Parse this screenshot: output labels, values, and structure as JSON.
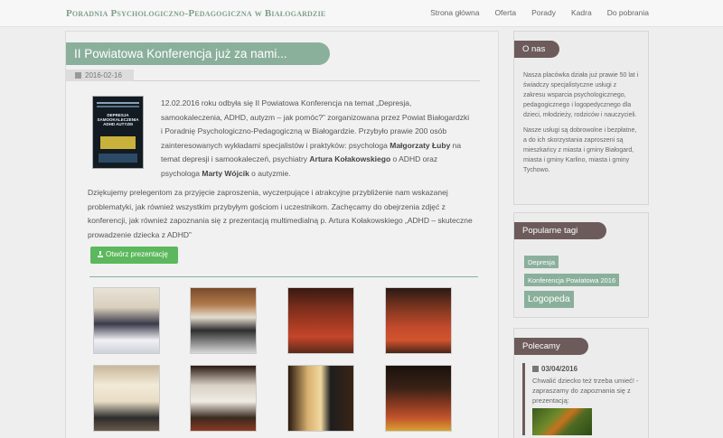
{
  "site": {
    "brand": "Poradnia Psychologiczno-Pedagogiczna w Białogardzie"
  },
  "nav": [
    {
      "label": "Strona główna"
    },
    {
      "label": "Oferta"
    },
    {
      "label": "Porady"
    },
    {
      "label": "Kadra"
    },
    {
      "label": "Do pobrania"
    }
  ],
  "post": {
    "title": "II Powiatowa Konferencja już za nami...",
    "date": "2016-02-16",
    "poster_title": "DEPRESJA SAMOOKALECZENIA ADHD AUTYZM",
    "lead_part1": "12.02.2016 roku odbyła się II Powiatowa Konferencja na temat „Depresja, samookaleczenia, ADHD, autyzm – jak pomóc?” zorganizowana przez Powiat Białogardzki i Poradnię Psychologiczno-Pedagogiczną w Białogardzie. Przybyło prawie 200 osób zainteresowanych wykładami specjalistów i praktyków: psychologa ",
    "speaker1": "Małgorzaty Łuby",
    "lead_part2": " na temat depresji i samookaleczeń, psychiatry ",
    "speaker2": "Artura Kołakowskiego",
    "lead_part3": " o ADHD oraz psychologa ",
    "speaker3": "Marty Wójcik",
    "lead_part4": " o autyzmie.",
    "para2": "Dziękujemy prelegentom za przyjęcie zaproszenia, wyczerpujące i atrakcyjne przybliżenie nam wskazanej problematyki, jak również wszystkim przybyłym gościom i uczestnikom. Zachęcamy do obejrzenia zdjęć z konferencji, jak również zapoznania się z prezentacją multimedialną p. Artura Kołakowskiego „ADHD – skuteczne prowadzenie dziecka z ADHD”",
    "button_label": "Otwórz prezentację"
  },
  "sidebar": {
    "about": {
      "heading": "O nas",
      "p1": "Nasza placówka działa już prawie 50 lat i świadczy specjalistyczne usługi z zakresu wsparcia psychologicznego, pedagogicznego i logopedycznego dla dzieci, młodzieży, rodziców i nauczycieli.",
      "p2": "Nasze usługi są dobrowolne i bezpłatne, a do ich skorzystania zaproszeni są mieszkańcy z miasta i gminy Białogard, miasta i gminy Karlino, miasta i gminy Tychowo."
    },
    "tags": {
      "heading": "Popularne tagi",
      "items": [
        "Depresja",
        "Konferencja Powiatowa 2016",
        "Logopeda"
      ]
    },
    "recommended": {
      "heading": "Polecamy",
      "date": "03/04/2016",
      "text": "Chwalić dziecko też trzeba umieć! - zapraszamy do zapoznania się z prezentacją:"
    }
  },
  "colors": {
    "accent": "#8ab09c",
    "sidebar_header": "#6d5b5b",
    "button": "#5cb85c"
  }
}
